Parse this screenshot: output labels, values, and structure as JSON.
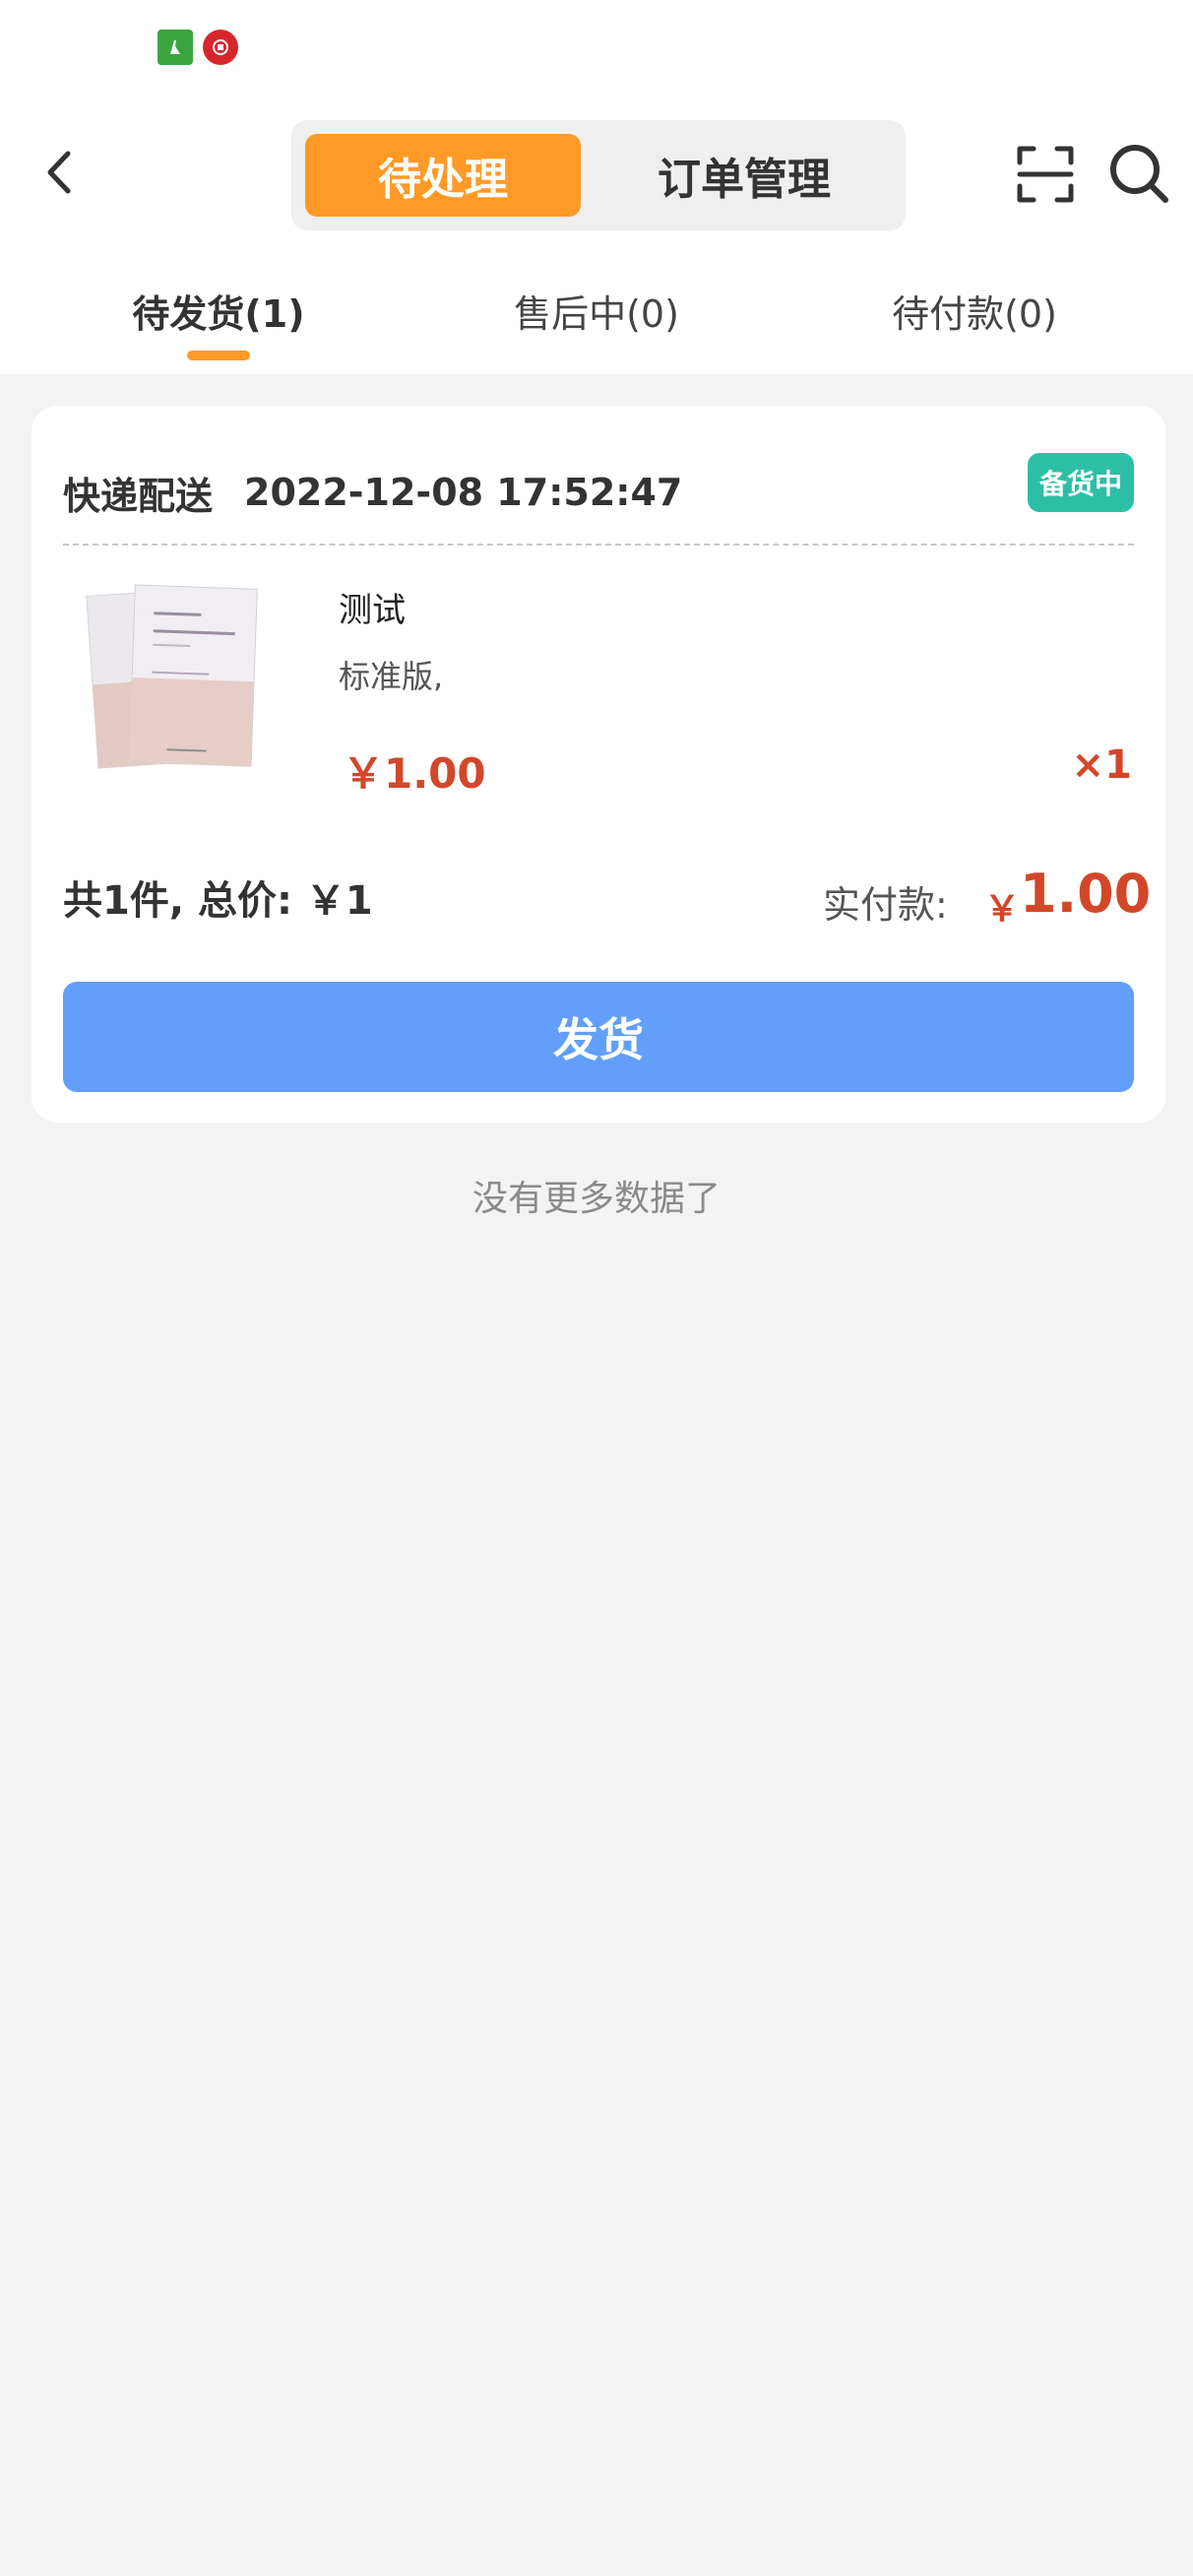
{
  "header": {
    "segments": [
      {
        "label": "待处理"
      },
      {
        "label": "订单管理"
      }
    ]
  },
  "tabs": [
    {
      "label": "待发货(1)"
    },
    {
      "label": "售后中(0)"
    },
    {
      "label": "待付款(0)"
    }
  ],
  "order": {
    "delivery_type": "快递配送",
    "datetime": "2022-12-08 17:52:47",
    "status": "备货中",
    "product": {
      "name": "测试",
      "spec": "标准版,",
      "price": "￥1.00",
      "qty": "×1"
    },
    "summary": "共1件, 总价: ￥1",
    "paid_label": "实付款:",
    "paid_currency": "￥",
    "paid_value": "1.00",
    "ship_button": "发货"
  },
  "footer": {
    "no_more": "没有更多数据了"
  },
  "icons": {
    "back": "chevron-left-icon",
    "scan": "scan-icon",
    "search": "search-icon"
  },
  "colors": {
    "accent_orange": "#ff9a27",
    "status_badge": "#2dbfa6",
    "price_red": "#d2472a",
    "ship_button": "#619ffa"
  }
}
